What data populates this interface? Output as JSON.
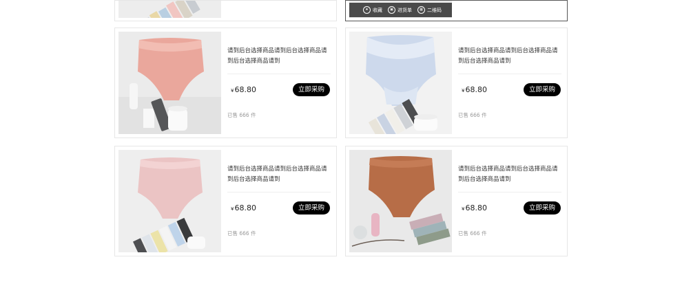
{
  "products": [
    {
      "title": "请到后台选择商品请到后台选择商品请到后台选择商品请到",
      "currency": "¥",
      "price": "68.80",
      "buy_label": "立即采购",
      "sold_text": "已售 666 件"
    },
    {
      "title": "请到后台选择商品请到后台选择商品请到后台选择商品请到",
      "currency": "¥",
      "price": "68.80",
      "buy_label": "立即采购",
      "sold_text": "已售 666 件"
    },
    {
      "title": "请到后台选择商品请到后台选择商品请到后台选择商品请到",
      "currency": "¥",
      "price": "68.80",
      "buy_label": "立即采购",
      "sold_text": "已售 666 件"
    },
    {
      "title": "请到后台选择商品请到后台选择商品请到后台选择商品请到",
      "currency": "¥",
      "price": "68.80",
      "buy_label": "立即采购",
      "sold_text": "已售 666 件"
    }
  ],
  "hover_actions": [
    {
      "label": "收藏",
      "icon": "star-icon"
    },
    {
      "label": "进货单",
      "icon": "cart-icon"
    },
    {
      "label": "二维码",
      "icon": "qr-icon"
    }
  ],
  "colors": {
    "button_bg": "#000000",
    "button_text": "#ffffff",
    "card_border": "#e6e6e6",
    "sold_text": "#999999"
  }
}
